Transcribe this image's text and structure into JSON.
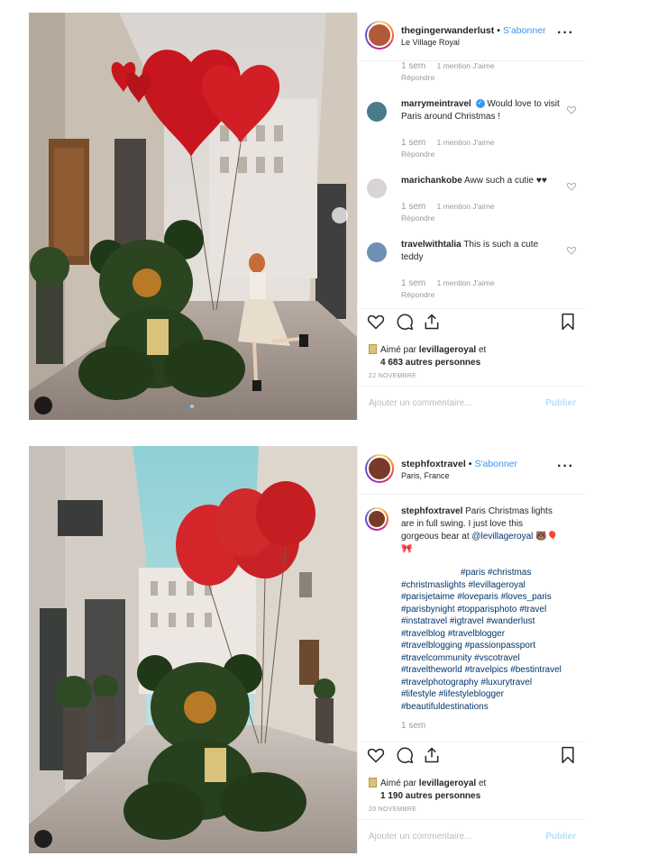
{
  "posts": [
    {
      "username": "thegingerwanderlust",
      "follow_label": "S'abonner",
      "location": "Le Village Royal",
      "comments": [
        {
          "username": "",
          "text": "",
          "time": "1 sem",
          "likes": "1 mention J'aime",
          "reply": "Répondre",
          "partial": true
        },
        {
          "username": "marrymeintravel",
          "text": "Would love to visit Paris around Christmas !",
          "time": "1 sem",
          "likes": "1 mention J'aime",
          "reply": "Répondre",
          "verified": true
        },
        {
          "username": "marichankobe",
          "text": "Aww such a cutie ♥♥",
          "time": "1 sem",
          "likes": "1 mention J'aime",
          "reply": "Répondre"
        },
        {
          "username": "travelwithtalia",
          "text": "This is such a cute teddy",
          "time": "1 sem",
          "likes": "1 mention J'aime",
          "reply": "Répondre"
        }
      ],
      "liked_by_prefix": "Aimé par",
      "liked_by_user": "levillageroyal",
      "liked_by_suffix": "et",
      "likes_count": "4 683 autres personnes",
      "date": "22 NOVEMBRE",
      "add_comment_placeholder": "Ajouter un commentaire...",
      "publish_label": "Publier"
    },
    {
      "username": "stephfoxtravel",
      "follow_label": "S'abonner",
      "location": "Paris, France",
      "caption_user": "stephfoxtravel",
      "caption_text": "Paris Christmas lights are in full swing. I just love this gorgeous bear at",
      "caption_mention": "@levillageroyal",
      "caption_emoji": "🐻🎈🎀",
      "hashtags": "#paris #christmas #christmaslights #levillageroyal #parisjetaime #loveparis #loves_paris #parisbynight #topparisphoto #travel #instatravel #igtravel #wanderlust #travelblog #travelblogger #travelblogging #passionpassport #travelcommunity #vscotravel #traveltheworld #travelpics #bestintravel #travelphotography #luxurytravel #lifestyle #lifestyleblogger #beautifuldestinations",
      "time": "1 sem",
      "liked_by_prefix": "Aimé par",
      "liked_by_user": "levillageroyal",
      "liked_by_suffix": "et",
      "likes_count": "1 190 autres personnes",
      "date": "20 NOVEMBRE",
      "add_comment_placeholder": "Ajouter un commentaire...",
      "publish_label": "Publier"
    }
  ],
  "colors": {
    "link": "#3897f0",
    "hashtag": "#003569",
    "muted": "#999999",
    "border": "#efefef"
  }
}
